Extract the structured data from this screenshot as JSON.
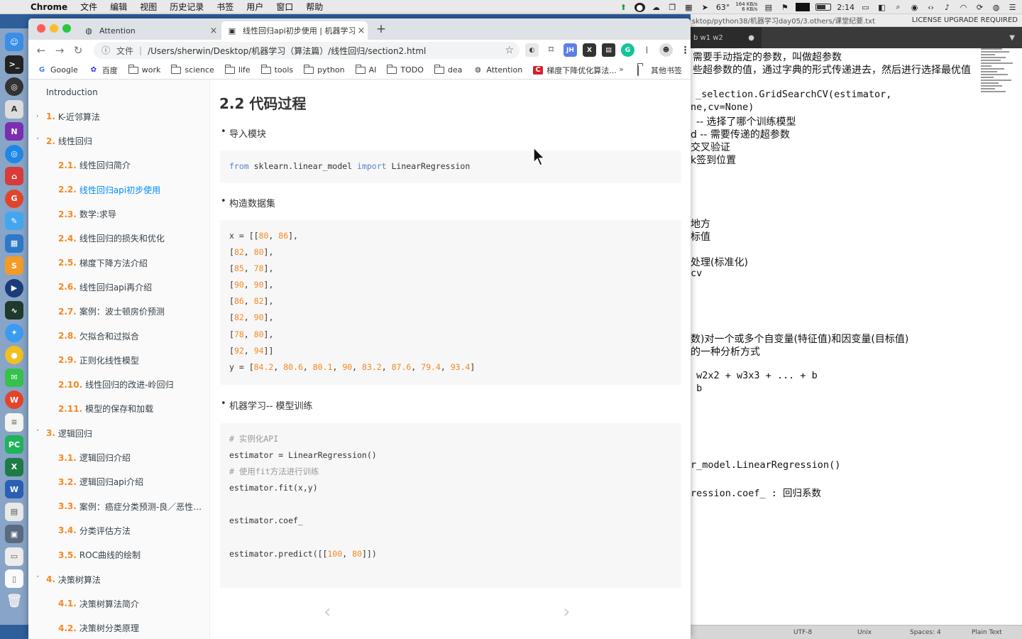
{
  "menubar": {
    "app": "Chrome",
    "items": [
      "文件",
      "编辑",
      "视图",
      "历史记录",
      "书签",
      "用户",
      "窗口",
      "帮助"
    ],
    "status": {
      "temp": "63°",
      "net_up": "164 KB/s",
      "net_down": "6 KB/s",
      "time": "2:14"
    }
  },
  "editor": {
    "title_path": "sktop/python38/机器学习day05/3.others/课堂纪要.txt",
    "license": "LICENSE UPGRADE REQUIRED",
    "tab": "b w1 w2",
    "lines": [
      "需要手动指定的参数，叫做超参数",
      "些超参数的值，通过字典的形式传递进去，然后进行选择最优值",
      "_selection.GridSearchCV(estimator,",
      "ne,cv=None)",
      "-- 选择了哪个训练模型",
      "d -- 需要传递的超参数",
      "交叉验证",
      "k签到位置",
      "地方",
      "标值",
      "处理(标准化)",
      "cv",
      "数)对一个或多个自变量(特征值)和因变量(目标值)",
      "的一种分析方式",
      " w2x2 + w3x3 + ... + b",
      " b",
      "r_model.LinearRegression()",
      "ression.coef_ : 回归系数"
    ],
    "status": {
      "encoding": "UTF-8",
      "line_endings": "Unix",
      "indent": "Spaces: 4",
      "syntax": "Plain Text"
    }
  },
  "chrome": {
    "tabs": [
      {
        "title": "Attention",
        "icon": "globe-icon",
        "active": false
      },
      {
        "title": "线性回归api初步使用 | 机器学习",
        "icon": "book-icon",
        "active": true
      }
    ],
    "address": {
      "scheme": "文件",
      "url": "/Users/sherwin/Desktop/机器学习（算法篇）/线性回归/section2.html"
    },
    "bookmarks": [
      "Google",
      "百度",
      "work",
      "science",
      "life",
      "tools",
      "python",
      "AI",
      "TODO",
      "dea",
      "Attention",
      "梯度下降优化算法..."
    ],
    "bookmarks_more": "»",
    "other_bookmarks": "其他书签",
    "extensions": [
      "JH",
      "X"
    ]
  },
  "sidebar": {
    "items": [
      {
        "num": "",
        "label": "Introduction",
        "level": 1,
        "arrow": ""
      },
      {
        "num": "1.",
        "label": "K-近邻算法",
        "level": 1,
        "arrow": "›"
      },
      {
        "num": "2.",
        "label": "线性回归",
        "level": 1,
        "arrow": "˅"
      },
      {
        "num": "2.1.",
        "label": "线性回归简介",
        "level": 2,
        "arrow": ""
      },
      {
        "num": "2.2.",
        "label": "线性回归api初步使用",
        "level": 2,
        "arrow": "",
        "active": true
      },
      {
        "num": "2.3.",
        "label": "数学:求导",
        "level": 2,
        "arrow": ""
      },
      {
        "num": "2.4.",
        "label": "线性回归的损失和优化",
        "level": 2,
        "arrow": ""
      },
      {
        "num": "2.5.",
        "label": "梯度下降方法介绍",
        "level": 2,
        "arrow": ""
      },
      {
        "num": "2.6.",
        "label": "线性回归api再介绍",
        "level": 2,
        "arrow": ""
      },
      {
        "num": "2.7.",
        "label": "案例：波士顿房价预测",
        "level": 2,
        "arrow": ""
      },
      {
        "num": "2.8.",
        "label": "欠拟合和过拟合",
        "level": 2,
        "arrow": ""
      },
      {
        "num": "2.9.",
        "label": "正则化线性模型",
        "level": 2,
        "arrow": ""
      },
      {
        "num": "2.10.",
        "label": "线性回归的改进-岭回归",
        "level": 2,
        "arrow": ""
      },
      {
        "num": "2.11.",
        "label": "模型的保存和加载",
        "level": 2,
        "arrow": ""
      },
      {
        "num": "3.",
        "label": "逻辑回归",
        "level": 1,
        "arrow": "˅"
      },
      {
        "num": "3.1.",
        "label": "逻辑回归介绍",
        "level": 2,
        "arrow": ""
      },
      {
        "num": "3.2.",
        "label": "逻辑回归api介绍",
        "level": 2,
        "arrow": ""
      },
      {
        "num": "3.3.",
        "label": "案例：癌症分类预测-良／恶性乳腺癌肿瘤预测",
        "level": 2,
        "arrow": ""
      },
      {
        "num": "3.4.",
        "label": "分类评估方法",
        "level": 2,
        "arrow": ""
      },
      {
        "num": "3.5.",
        "label": "ROC曲线的绘制",
        "level": 2,
        "arrow": ""
      },
      {
        "num": "4.",
        "label": "决策树算法",
        "level": 1,
        "arrow": "˅"
      },
      {
        "num": "4.1.",
        "label": "决策树算法简介",
        "level": 2,
        "arrow": ""
      },
      {
        "num": "4.2.",
        "label": "决策树分类原理",
        "level": 2,
        "arrow": ""
      }
    ]
  },
  "content": {
    "title": "2.2 代码过程",
    "sections": [
      {
        "bullet": "导入模块",
        "code": [
          [
            {
              "t": "from",
              "c": "kw"
            },
            {
              "t": " sklearn.linear_model "
            },
            {
              "t": "import",
              "c": "kw"
            },
            {
              "t": " LinearRegression"
            }
          ]
        ]
      },
      {
        "bullet": "构造数据集",
        "code": [
          [
            {
              "t": "x = [["
            },
            {
              "t": "80",
              "c": "num"
            },
            {
              "t": ", "
            },
            {
              "t": "86",
              "c": "num"
            },
            {
              "t": "],"
            }
          ],
          [
            {
              "t": "["
            },
            {
              "t": "82",
              "c": "num"
            },
            {
              "t": ", "
            },
            {
              "t": "80",
              "c": "num"
            },
            {
              "t": "],"
            }
          ],
          [
            {
              "t": "["
            },
            {
              "t": "85",
              "c": "num"
            },
            {
              "t": ", "
            },
            {
              "t": "78",
              "c": "num"
            },
            {
              "t": "],"
            }
          ],
          [
            {
              "t": "["
            },
            {
              "t": "90",
              "c": "num"
            },
            {
              "t": ", "
            },
            {
              "t": "90",
              "c": "num"
            },
            {
              "t": "],"
            }
          ],
          [
            {
              "t": "["
            },
            {
              "t": "86",
              "c": "num"
            },
            {
              "t": ", "
            },
            {
              "t": "82",
              "c": "num"
            },
            {
              "t": "],"
            }
          ],
          [
            {
              "t": "["
            },
            {
              "t": "82",
              "c": "num"
            },
            {
              "t": ", "
            },
            {
              "t": "90",
              "c": "num"
            },
            {
              "t": "],"
            }
          ],
          [
            {
              "t": "["
            },
            {
              "t": "78",
              "c": "num"
            },
            {
              "t": ", "
            },
            {
              "t": "80",
              "c": "num"
            },
            {
              "t": "],"
            }
          ],
          [
            {
              "t": "["
            },
            {
              "t": "92",
              "c": "num"
            },
            {
              "t": ", "
            },
            {
              "t": "94",
              "c": "num"
            },
            {
              "t": "]]"
            }
          ],
          [
            {
              "t": "y = ["
            },
            {
              "t": "84.2",
              "c": "num"
            },
            {
              "t": ", "
            },
            {
              "t": "80.6",
              "c": "num"
            },
            {
              "t": ", "
            },
            {
              "t": "80.1",
              "c": "num"
            },
            {
              "t": ", "
            },
            {
              "t": "90",
              "c": "num"
            },
            {
              "t": ", "
            },
            {
              "t": "83.2",
              "c": "num"
            },
            {
              "t": ", "
            },
            {
              "t": "87.6",
              "c": "num"
            },
            {
              "t": ", "
            },
            {
              "t": "79.4",
              "c": "num"
            },
            {
              "t": ", "
            },
            {
              "t": "93.4",
              "c": "num"
            },
            {
              "t": "]"
            }
          ]
        ]
      },
      {
        "bullet": "机器学习-- 模型训练",
        "code": [
          [
            {
              "t": "# 实例化API",
              "c": "cmt"
            }
          ],
          [
            {
              "t": "estimator = LinearRegression()"
            }
          ],
          [
            {
              "t": "# 使用fit方法进行训练",
              "c": "cmt"
            }
          ],
          [
            {
              "t": "estimator.fit(x,y)"
            }
          ],
          [
            {
              "t": ""
            }
          ],
          [
            {
              "t": "estimator.coef_"
            }
          ],
          [
            {
              "t": ""
            }
          ],
          [
            {
              "t": "estimator.predict([["
            },
            {
              "t": "100",
              "c": "num"
            },
            {
              "t": ", "
            },
            {
              "t": "80",
              "c": "num"
            },
            {
              "t": "]])"
            }
          ]
        ]
      }
    ],
    "pager": {
      "prev": "‹",
      "next": "›"
    }
  },
  "colors": {
    "link_active": "#008cff",
    "keyword": "#5b84c5",
    "number": "#f5871f",
    "comment": "#999999"
  }
}
